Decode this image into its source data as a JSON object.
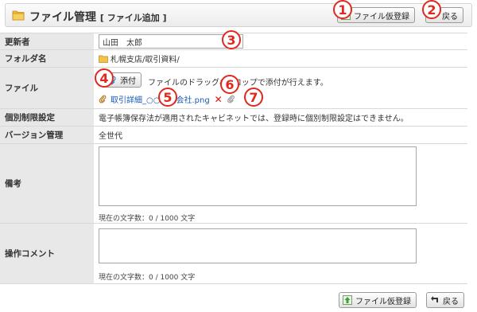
{
  "header": {
    "title": "ファイル管理",
    "subtitle": "[ ファイル追加 ]",
    "register_label": "ファイル仮登録",
    "back_label": "戻る"
  },
  "badges": [
    "1",
    "2",
    "3",
    "4",
    "5",
    "6",
    "7"
  ],
  "form": {
    "updater": {
      "label": "更新者",
      "value": "山田　太郎"
    },
    "folder": {
      "label": "フォルダ名",
      "value": "札幌支店/取引資料/"
    },
    "file": {
      "label": "ファイル",
      "attach_label": "添付",
      "hint": "ファイルのドラッグ&ドロップで添付が行えます。",
      "filename": "取引詳細_○○株式会社.png"
    },
    "restriction": {
      "label": "個別制限設定",
      "value": "電子帳簿保存法が適用されたキャビネットでは、登録時に個別制限設定はできません。"
    },
    "version": {
      "label": "バージョン管理",
      "value": "全世代"
    },
    "note": {
      "label": "備考",
      "value": "",
      "counter": "現在の文字数：0 /  1000  文字"
    },
    "comment": {
      "label": "操作コメント",
      "value": "",
      "counter": "現在の文字数：0 /  1000  文字"
    }
  },
  "footer": {
    "register_label": "ファイル仮登録",
    "back_label": "戻る"
  },
  "colors": {
    "badge": "#e0281e",
    "label_bg": "#e8e8e8",
    "link": "#1a5bb5"
  }
}
